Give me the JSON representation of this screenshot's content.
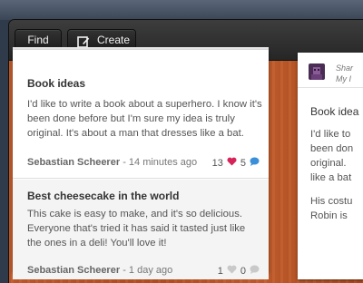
{
  "toolbar": {
    "find_label": "Find",
    "create_label": "Create"
  },
  "cards": [
    {
      "title": "Book ideas",
      "body_lines": [
        "I'd like to write a book about a superhero. I know it's",
        "been done before but I'm sure my idea is truly",
        "original. It's about a man that dresses like a bat."
      ],
      "author": "Sebastian Scheerer",
      "time": "- 14 minutes ago",
      "likes": "13",
      "comments": "5"
    },
    {
      "title": "Best cheesecake in the world",
      "body_lines": [
        "This cake is easy to make, and it's so delicious.",
        "Everyone that's tried it has said it tasted just like",
        "the ones in a deli! You'll love it!"
      ],
      "author": "Sebastian Scheerer",
      "time": "- 1 day ago",
      "likes": "1",
      "comments": "0"
    }
  ],
  "right_card": {
    "user": "Shar",
    "subtitle": "My I",
    "title": "Book idea",
    "lines": [
      "I'd like to",
      "been don",
      "original.",
      "like a bat",
      "His costu",
      "Robin is"
    ]
  },
  "colors": {
    "heart": "#d6245a",
    "comment": "#3a8fd8",
    "wood": "#c05a2a"
  }
}
